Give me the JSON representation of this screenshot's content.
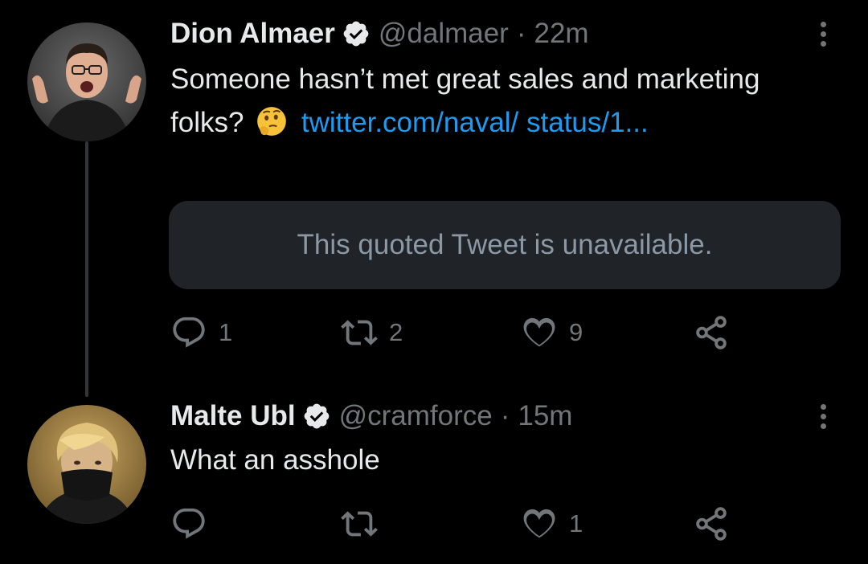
{
  "tweets": [
    {
      "author_name": "Dion Almaer",
      "handle": "@dalmaer",
      "separator": "·",
      "time": "22m",
      "text_before": "Someone hasn’t met great sales and marketing folks?",
      "emoji": "thinking-face-emoji",
      "link_text": "twitter.com/naval/ status/1...",
      "quoted_tweet_notice": "This quoted Tweet is unavailable.",
      "reply_count": "1",
      "retweet_count": "2",
      "like_count": "9",
      "avatar_icon": "person-avatar",
      "verified_icon": "verified-badge-icon"
    },
    {
      "author_name": "Malte Ubl",
      "handle": "@cramforce",
      "separator": "·",
      "time": "15m",
      "text": "What an asshole",
      "reply_count": "",
      "retweet_count": "",
      "like_count": "1",
      "avatar_icon": "person-avatar",
      "verified_icon": "verified-badge-icon"
    }
  ],
  "icons": {
    "reply": "reply-icon",
    "retweet": "retweet-icon",
    "like": "heart-icon",
    "share": "share-icon",
    "more": "more-options-icon"
  },
  "colors": {
    "background": "#000000",
    "text": "#e7e9ea",
    "secondary": "#71767b",
    "link": "#1d9bf0",
    "quote_bg": "#202327",
    "thread_line": "#333639"
  }
}
